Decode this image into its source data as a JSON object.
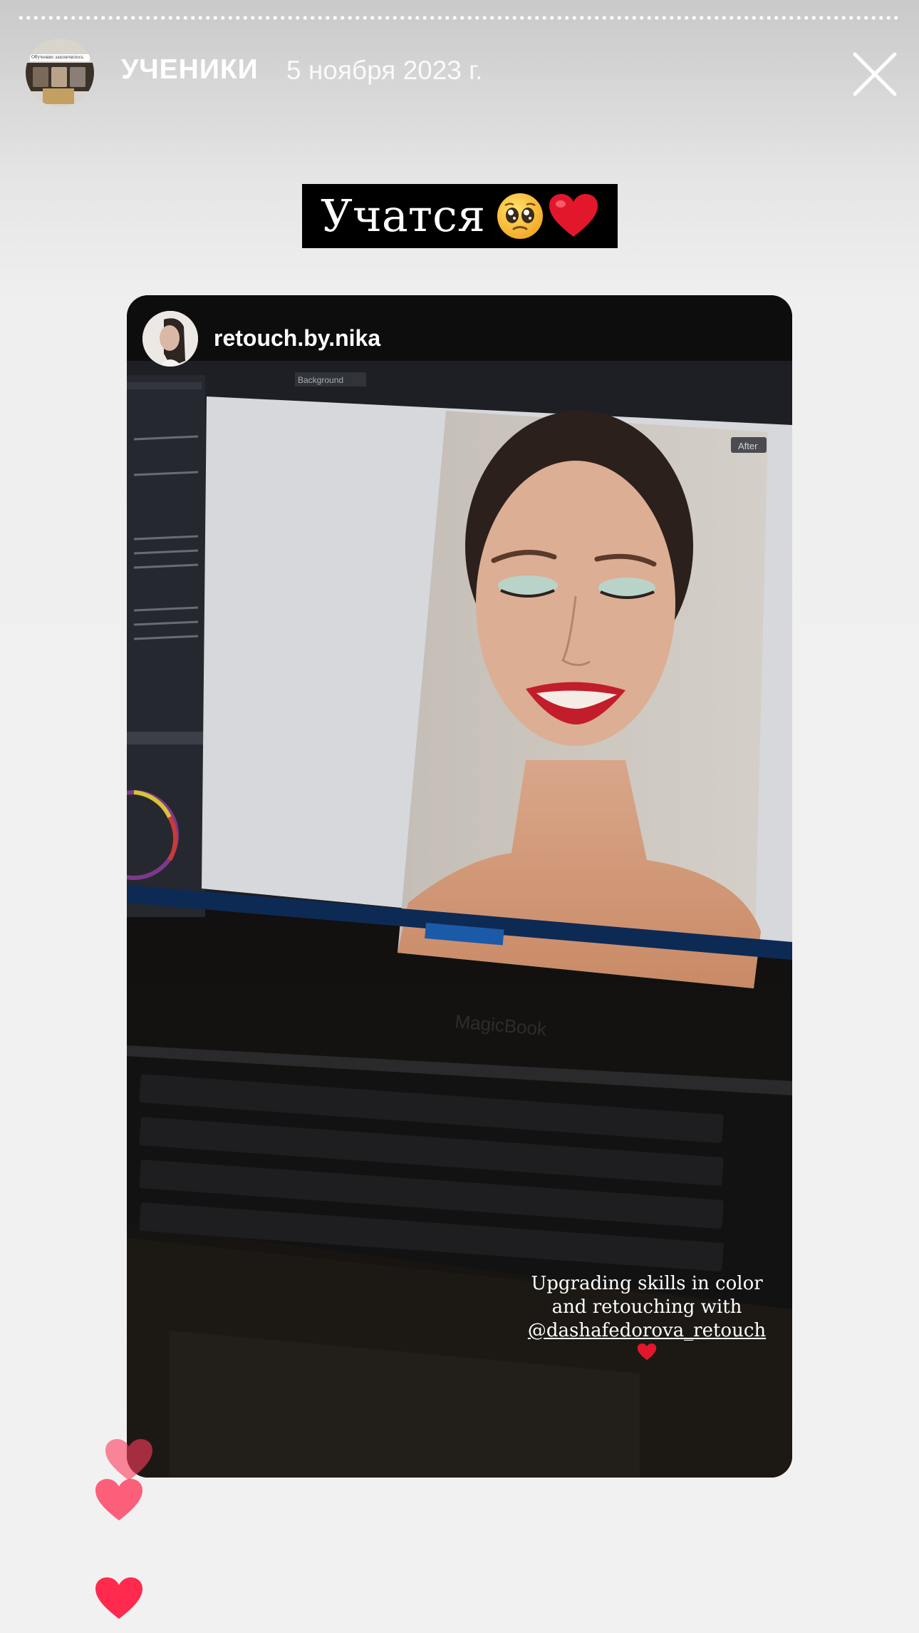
{
  "story": {
    "title": "УЧЕНИКИ",
    "date": "5 ноября 2023 г.",
    "avatar_caption": "Обучение закончилось"
  },
  "caption": {
    "text": "Учатся",
    "emoji": [
      "pleading-face",
      "red-heart"
    ]
  },
  "reshare": {
    "username": "retouch.by.nika",
    "caption_lines": [
      "Upgrading skills in color",
      "and retouching with"
    ],
    "mention": "@dashafedorova_retouch",
    "caption_emoji": "red-heart",
    "laptop_brand": "MagicBook",
    "screen_after_label": "After",
    "screen_layer_label": "Background"
  },
  "reactions": [
    "heart",
    "heart",
    "heart"
  ],
  "colors": {
    "accent_heart": "#ff3b5c",
    "caption_bg": "#000000"
  }
}
